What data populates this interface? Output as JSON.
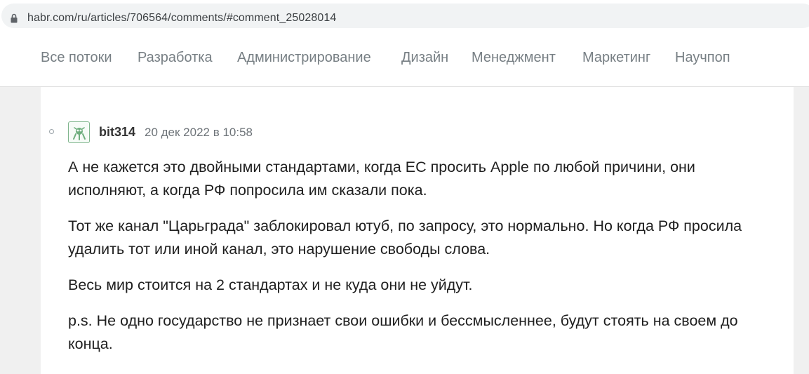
{
  "browser": {
    "url": "habr.com/ru/articles/706564/comments/#comment_25028014",
    "lock_icon": "lock-icon"
  },
  "nav": {
    "items": [
      {
        "label": "Все потоки"
      },
      {
        "label": "Разработка"
      },
      {
        "label": "Администрирование"
      },
      {
        "label": "Дизайн"
      },
      {
        "label": "Менеджмент"
      },
      {
        "label": "Маркетинг"
      },
      {
        "label": "Научпоп"
      }
    ]
  },
  "comment": {
    "author": "bit314",
    "timestamp": "20 дек 2022 в 10:58",
    "avatar_icon": "robot-avatar-icon",
    "paragraphs": [
      "А не кажется это двойными стандартами, когда ЕС просить Apple по любой причини, они исполняют, а когда РФ попросила им сказали пока.",
      "Тот же канал \"Царьграда\" заблокировал ютуб, по запросу, это нормально. Но когда РФ просила удалить тот или иной канал, это нарушение свободы слова.",
      "Весь мир стоится на 2 стандартах и не куда они не уйдут.",
      "p.s. Не одно государство не признает свои ошибки и бессмысленнее, будут стоять на своем до конца."
    ]
  },
  "colors": {
    "nav_text": "#777f84",
    "body_text": "#1f1f1f",
    "avatar_accent": "#7fb58c",
    "page_bg": "#f0f0f0"
  }
}
